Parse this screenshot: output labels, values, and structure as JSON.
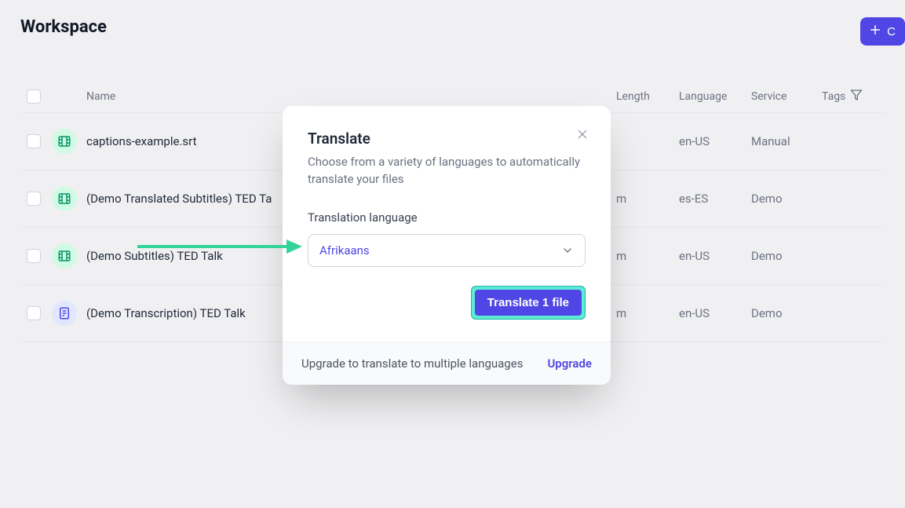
{
  "header": {
    "title": "Workspace",
    "create_label": "C"
  },
  "table": {
    "columns": {
      "name": "Name",
      "length": "Length",
      "language": "Language",
      "service": "Service",
      "tags": "Tags"
    },
    "rows": [
      {
        "name": "captions-example.srt",
        "length": "",
        "language": "en-US",
        "service": "Manual",
        "icon": "film",
        "tint": "green"
      },
      {
        "name": "(Demo Translated Subtitles) TED Ta",
        "length": "m",
        "language": "es-ES",
        "service": "Demo",
        "icon": "film",
        "tint": "green"
      },
      {
        "name": "(Demo Subtitles) TED Talk",
        "length": "m",
        "language": "en-US",
        "service": "Demo",
        "icon": "film",
        "tint": "green"
      },
      {
        "name": "(Demo Transcription) TED Talk",
        "length": "m",
        "language": "en-US",
        "service": "Demo",
        "icon": "doc",
        "tint": "indigo"
      }
    ]
  },
  "modal": {
    "title": "Translate",
    "description": "Choose from a variety of languages to automatically translate your files",
    "field_label": "Translation language",
    "selected_language": "Afrikaans",
    "action_label": "Translate 1 file",
    "footer_text": "Upgrade to translate to multiple languages",
    "upgrade_label": "Upgrade"
  }
}
